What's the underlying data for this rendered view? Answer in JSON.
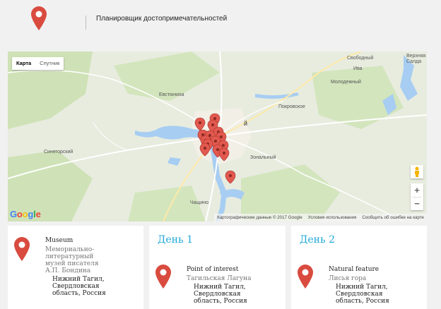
{
  "header": {
    "title": "Планировщик достопримечательностей"
  },
  "map": {
    "type_buttons": [
      "Карта",
      "Спутник"
    ],
    "active_type": "Карта",
    "zoom_in": "+",
    "zoom_out": "−",
    "google_logo": "Google",
    "attribution": [
      "Картографические данные © 2017 Google",
      "Условия использования",
      "Сообщить об ошибке на карте"
    ],
    "place_labels": [
      "Свободный",
      "Верхняя Салда",
      "Ива",
      "Евстюниха",
      "Молодежный",
      "Покровское",
      "Синегорский",
      "Зональный",
      "Чащино",
      "й"
    ]
  },
  "cards": [
    {
      "type": "Museum",
      "name": "Мемориально-литературный музей писателя А.П. Бондина",
      "address": "Нижний Тагил, Свердловская область, Россия"
    },
    {
      "day": "День 1",
      "type": "Point of interest",
      "name": "Тагильская Лагуна",
      "address": "Нижний Тагил, Свердловская область, Россия"
    },
    {
      "day": "День 2",
      "type": "Natural feature",
      "name": "Лисья гора",
      "address": "Нижний Тагил, Свердловская область, Россия"
    }
  ],
  "colors": {
    "pin": "#d94b3f",
    "day_heading": "#1fa8d8",
    "water": "#a7cdf2",
    "park": "#c8dfaf"
  }
}
